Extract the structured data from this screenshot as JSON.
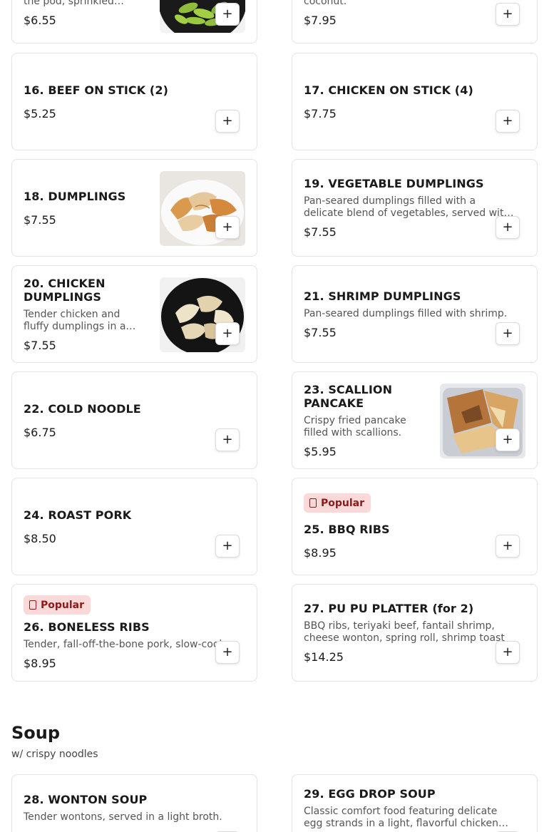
{
  "add_symbol": "+",
  "accent_colors": {
    "badge_bg": "#fbd9d9",
    "badge_text": "#8b1a1a",
    "border": "#e3e3e3"
  },
  "items": [
    {
      "name": "",
      "desc": "the pod, sprinkled…",
      "price": "$6.55"
    },
    {
      "name": "",
      "desc": "coconut.",
      "price": "$7.95"
    },
    {
      "name": "16. BEEF ON STICK (2)",
      "price": "$5.25"
    },
    {
      "name": "17. CHICKEN ON STICK (4)",
      "price": "$7.75"
    },
    {
      "name": "18. DUMPLINGS",
      "price": "$7.55"
    },
    {
      "name": "19. VEGETABLE DUMPLINGS",
      "desc": "Pan-seared dumplings filled with a delicate blend of vegetables, served with a light",
      "price": "$7.55"
    },
    {
      "name": "20. CHICKEN DUMPLINGS",
      "desc": "Tender chicken and fluffy dumplings in a…",
      "price": "$7.55"
    },
    {
      "name": "21. SHRIMP DUMPLINGS",
      "desc": "Pan-seared dumplings filled with shrimp.",
      "price": "$7.55"
    },
    {
      "name": "22. COLD NOODLE",
      "price": "$6.75"
    },
    {
      "name": "23. SCALLION PANCAKE",
      "desc": "Crispy fried pancake filled with scallions.",
      "price": "$5.95"
    },
    {
      "name": "24. ROAST PORK",
      "price": "$8.50"
    },
    {
      "name": "25. BBQ RIBS",
      "badge": "Popular",
      "price": "$8.95"
    },
    {
      "name": "26. BONELESS RIBS",
      "badge": "Popular",
      "desc": "Tender, fall-off-the-bone pork, slow-cooked",
      "price": "$8.95"
    },
    {
      "name": "27. PU PU PLATTER (for 2)",
      "desc": "BBQ ribs, teriyaki beef, fantail shrimp, cheese wonton, spring roll, shrimp toast",
      "price": "$14.25"
    },
    {
      "name": "28. WONTON SOUP",
      "desc": "Tender wontons, served in a light broth."
    },
    {
      "name": "29. EGG DROP SOUP",
      "desc": "Classic comfort food featuring delicate egg strands in a light, flavorful chicken broth"
    }
  ],
  "section": {
    "title": "Soup",
    "subtitle": "w/ crispy noodles"
  }
}
